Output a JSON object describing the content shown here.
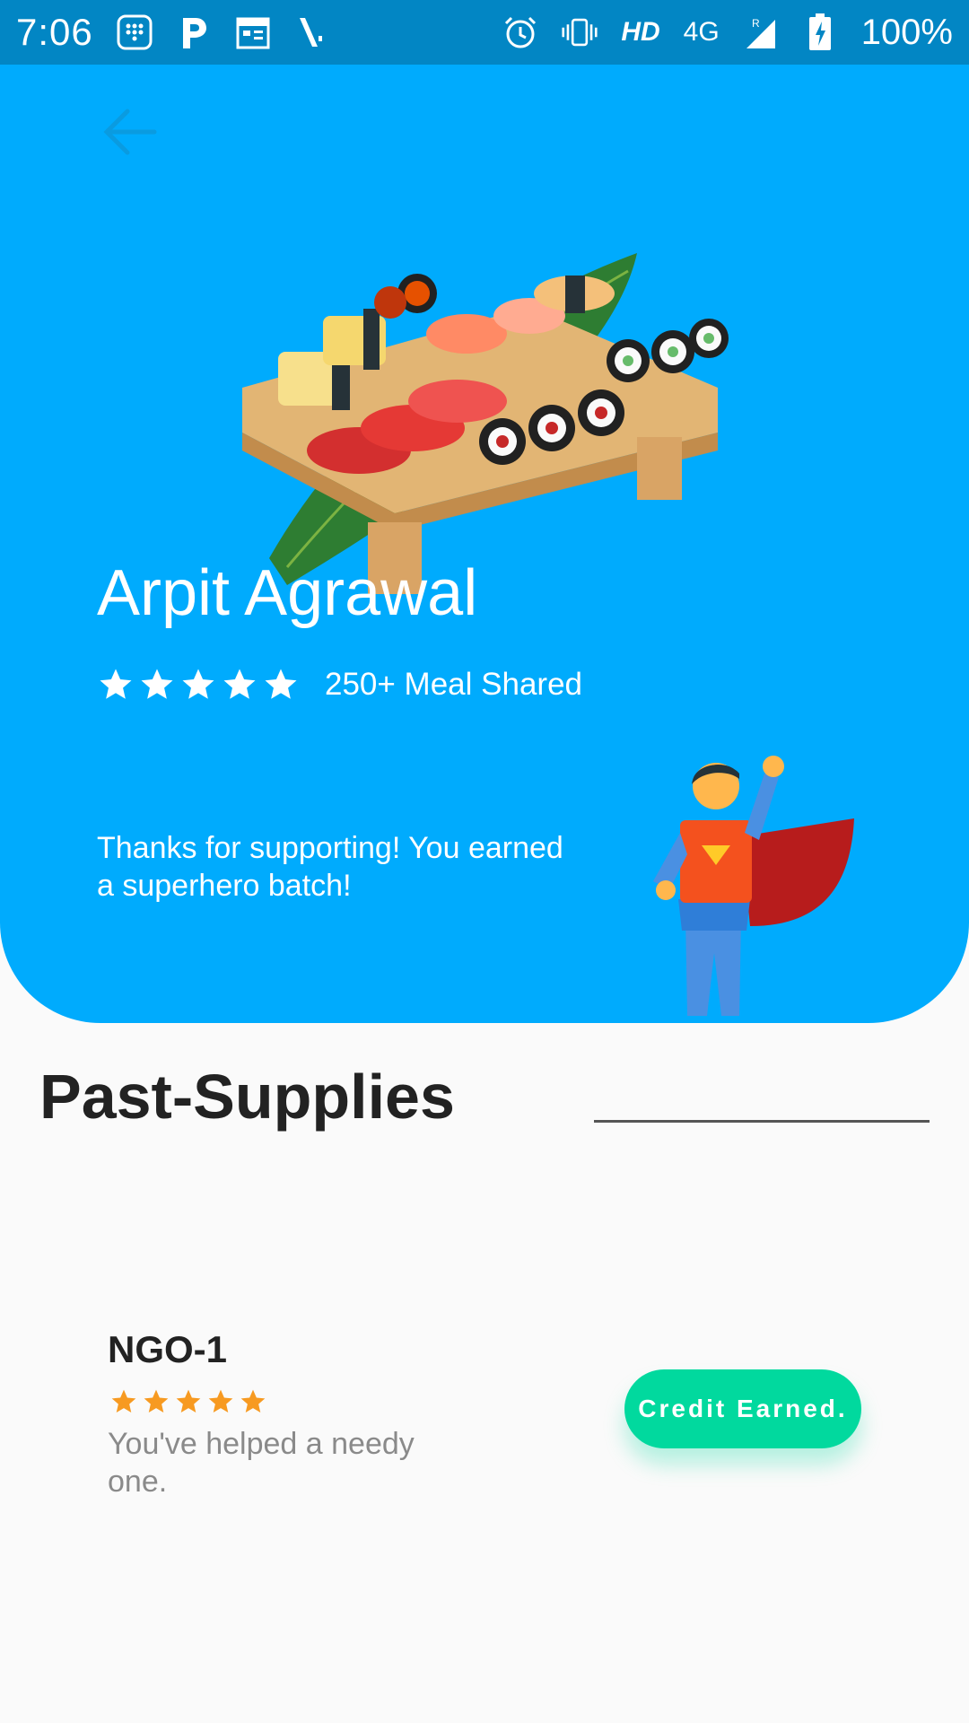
{
  "status_bar": {
    "time": "7:06",
    "network_hd": "HD",
    "network_type": "4G",
    "battery": "100%"
  },
  "hero": {
    "background_color": "#00abfd",
    "user_name": "Arpit Agrawal",
    "rating": 5,
    "rating_max": 5,
    "meals_shared": "250+ Meal Shared",
    "thanks_message": "Thanks for supporting! You earned a superhero batch!"
  },
  "past_supplies": {
    "title": "Past-Supplies",
    "items": [
      {
        "name": "NGO-1",
        "rating": 5,
        "message": "You've helped a needy one.",
        "button_label": "Credit Earned.",
        "button_color": "#01d99e"
      }
    ]
  }
}
